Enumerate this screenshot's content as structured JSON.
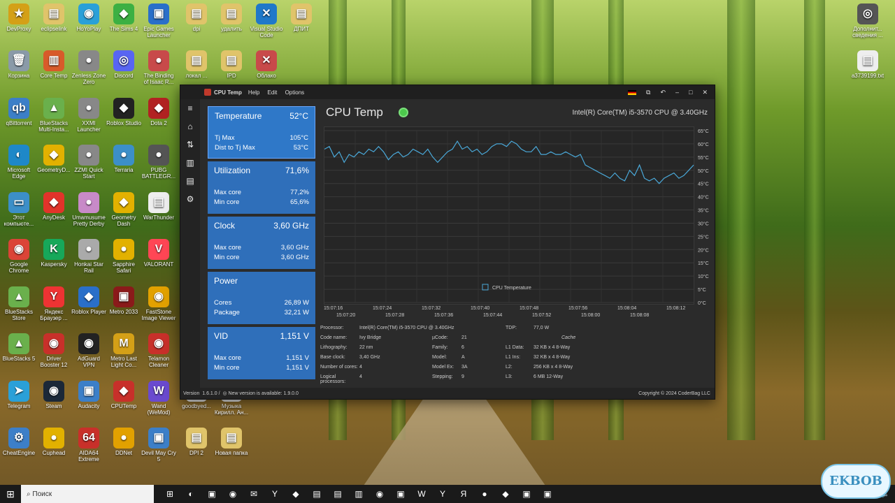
{
  "desktop_icons": [
    {
      "label": "DevProxy",
      "glyph": "★",
      "color": "#d4a017",
      "x": 2,
      "y": 5
    },
    {
      "label": "eclipselink",
      "glyph": "▤",
      "color": "#e0c46a",
      "x": 52,
      "y": 5
    },
    {
      "label": "HoYoPlay",
      "glyph": "◉",
      "color": "#2aa0d8",
      "x": 102,
      "y": 5
    },
    {
      "label": "The Sims 4",
      "glyph": "◆",
      "color": "#3cb043",
      "x": 152,
      "y": 5
    },
    {
      "label": "Epic Games Launcher",
      "glyph": "▣",
      "color": "#2a6fc9",
      "x": 202,
      "y": 5
    },
    {
      "label": "dpi",
      "glyph": "▤",
      "color": "#e0c46a",
      "x": 256,
      "y": 5
    },
    {
      "label": "удалить",
      "glyph": "▤",
      "color": "#e0c46a",
      "x": 306,
      "y": 5
    },
    {
      "label": "Visual Studio Code",
      "glyph": "✕",
      "color": "#1f78c9",
      "x": 356,
      "y": 5
    },
    {
      "label": "ДПИТ",
      "glyph": "▤",
      "color": "#e0c46a",
      "x": 406,
      "y": 5
    },
    {
      "label": "Корзина",
      "glyph": "🗑",
      "color": "#8a9aa8",
      "x": 2,
      "y": 72
    },
    {
      "label": "Core Temp",
      "glyph": "▥",
      "color": "#d85a2a",
      "x": 52,
      "y": 72
    },
    {
      "label": "Zenless Zone Zero",
      "glyph": "●",
      "color": "#888",
      "x": 102,
      "y": 72
    },
    {
      "label": "Discord",
      "glyph": "◎",
      "color": "#5865f2",
      "x": 152,
      "y": 72
    },
    {
      "label": "The Binding of Isaac R...",
      "glyph": "●",
      "color": "#c84a4a",
      "x": 202,
      "y": 72
    },
    {
      "label": "локал ...",
      "glyph": "▤",
      "color": "#e0c46a",
      "x": 256,
      "y": 72
    },
    {
      "label": "IPD",
      "glyph": "▤",
      "color": "#e0c46a",
      "x": 306,
      "y": 72
    },
    {
      "label": "Облако",
      "glyph": "✕",
      "color": "#c84a4a",
      "x": 356,
      "y": 72
    },
    {
      "label": "qBittorrent",
      "glyph": "qb",
      "color": "#3c7fc8",
      "x": 2,
      "y": 140
    },
    {
      "label": "BlueStacks Multi-Insta...",
      "glyph": "▲",
      "color": "#6ab04c",
      "x": 52,
      "y": 140
    },
    {
      "label": "XXMI Launcher",
      "glyph": "●",
      "color": "#888",
      "x": 102,
      "y": 140
    },
    {
      "label": "Roblox Studio",
      "glyph": "◆",
      "color": "#222",
      "x": 152,
      "y": 140
    },
    {
      "label": "Dota 2",
      "glyph": "◆",
      "color": "#b22222",
      "x": 202,
      "y": 140
    },
    {
      "label": "Microsoft Edge",
      "glyph": "◐",
      "color": "#1e88c8",
      "x": 2,
      "y": 207
    },
    {
      "label": "GeometryD...",
      "glyph": "◆",
      "color": "#e2b100",
      "x": 52,
      "y": 207
    },
    {
      "label": "ZZMI Quick Start",
      "glyph": "●",
      "color": "#888",
      "x": 102,
      "y": 207
    },
    {
      "label": "Terraria",
      "glyph": "●",
      "color": "#3c8fc8",
      "x": 152,
      "y": 207
    },
    {
      "label": "PUBG BATTLEGR...",
      "glyph": "●",
      "color": "#555",
      "x": 202,
      "y": 207
    },
    {
      "label": "Этот компьюте...",
      "glyph": "▭",
      "color": "#3c8fc8",
      "x": 2,
      "y": 275
    },
    {
      "label": "AnyDesk",
      "glyph": "◆",
      "color": "#e2332a",
      "x": 52,
      "y": 275
    },
    {
      "label": "Umamusume Pretty Derby",
      "glyph": "●",
      "color": "#c88ac8",
      "x": 102,
      "y": 275
    },
    {
      "label": "Geometry Dash",
      "glyph": "◆",
      "color": "#e2b100",
      "x": 152,
      "y": 275
    },
    {
      "label": "WarThunder",
      "glyph": "▤",
      "color": "#eee",
      "x": 202,
      "y": 275
    },
    {
      "label": "Google Chrome",
      "glyph": "◉",
      "color": "#db4437",
      "x": 2,
      "y": 342
    },
    {
      "label": "Kaspersky",
      "glyph": "K",
      "color": "#17a85a",
      "x": 52,
      "y": 342
    },
    {
      "label": "Honkai Star Rail",
      "glyph": "●",
      "color": "#aaa",
      "x": 102,
      "y": 342
    },
    {
      "label": "Sapphire Safari",
      "glyph": "●",
      "color": "#e2b100",
      "x": 152,
      "y": 342
    },
    {
      "label": "VALORANT",
      "glyph": "V",
      "color": "#ff4655",
      "x": 202,
      "y": 342
    },
    {
      "label": "BlueStacks Store",
      "glyph": "▲",
      "color": "#6ab04c",
      "x": 2,
      "y": 410
    },
    {
      "label": "Яндекс Браузер ...",
      "glyph": "Y",
      "color": "#e33",
      "x": 52,
      "y": 410
    },
    {
      "label": "Roblox Player",
      "glyph": "◆",
      "color": "#2a6fc9",
      "x": 102,
      "y": 410
    },
    {
      "label": "Metro 2033",
      "glyph": "▣",
      "color": "#8a1a1a",
      "x": 152,
      "y": 410
    },
    {
      "label": "FastStone Image Viewer",
      "glyph": "◉",
      "color": "#e2a100",
      "x": 202,
      "y": 410
    },
    {
      "label": "BlueStacks 5",
      "glyph": "▲",
      "color": "#6ab04c",
      "x": 2,
      "y": 477
    },
    {
      "label": "Driver Booster 12",
      "glyph": "◉",
      "color": "#c8302a",
      "x": 52,
      "y": 477
    },
    {
      "label": "AdGuard VPN",
      "glyph": "◉",
      "color": "#222",
      "x": 102,
      "y": 477
    },
    {
      "label": "Metro Last Light Co...",
      "glyph": "M",
      "color": "#d4a017",
      "x": 152,
      "y": 477
    },
    {
      "label": "Telamon Cleaner",
      "glyph": "◉",
      "color": "#c8302a",
      "x": 202,
      "y": 477
    },
    {
      "label": "Telegram",
      "glyph": "➤",
      "color": "#2aa0d8",
      "x": 2,
      "y": 545
    },
    {
      "label": "Steam",
      "glyph": "◉",
      "color": "#1b2838",
      "x": 52,
      "y": 545
    },
    {
      "label": "Audacity",
      "glyph": "▣",
      "color": "#3c7fc8",
      "x": 102,
      "y": 545
    },
    {
      "label": "CPUTemp",
      "glyph": "◆",
      "color": "#c8302a",
      "x": 152,
      "y": 545
    },
    {
      "label": "Wand (WeMod)",
      "glyph": "W",
      "color": "#6a4acf",
      "x": 202,
      "y": 545
    },
    {
      "label": "goodbyed...",
      "glyph": "▤",
      "color": "#eee",
      "x": 256,
      "y": 545
    },
    {
      "label": "Музыка Кирилл. Ан...",
      "glyph": "▤",
      "color": "#eee",
      "x": 306,
      "y": 545
    },
    {
      "label": "CheatEngine",
      "glyph": "⚙",
      "color": "#3c7fc8",
      "x": 2,
      "y": 612
    },
    {
      "label": "Cuphead",
      "glyph": "●",
      "color": "#e2b100",
      "x": 52,
      "y": 612
    },
    {
      "label": "AIDA64 Extreme",
      "glyph": "64",
      "color": "#c8302a",
      "x": 102,
      "y": 612
    },
    {
      "label": "DDNet",
      "glyph": "●",
      "color": "#e2a100",
      "x": 152,
      "y": 612
    },
    {
      "label": "Devil May Cry 5",
      "glyph": "▣",
      "color": "#3c7fc8",
      "x": 202,
      "y": 612
    },
    {
      "label": "DPI 2",
      "glyph": "▤",
      "color": "#e0c46a",
      "x": 256,
      "y": 612
    },
    {
      "label": "Новая папка",
      "glyph": "▤",
      "color": "#e0c46a",
      "x": 306,
      "y": 612
    },
    {
      "label": "Дополнит... сведения ...",
      "glyph": "◎",
      "color": "#555",
      "x": 1216,
      "y": 5
    },
    {
      "label": "a3739199.txt",
      "glyph": "▤",
      "color": "#eee",
      "x": 1216,
      "y": 72
    }
  ],
  "window": {
    "menu": {
      "title": "CPU Temp",
      "help": "Help",
      "edit": "Edit",
      "options": "Options"
    },
    "controls": {
      "minimize": "–",
      "maximize": "□",
      "close": "✕",
      "back": "↶",
      "screenshot": "⧉"
    },
    "sidebar": [
      "≡",
      "⌂",
      "⇅",
      "▥",
      "▤",
      "⚙"
    ],
    "header": {
      "app_name": "CPU Temp",
      "cpu_name": "Intel(R) Core(TM) i5-3570 CPU @ 3.40GHz"
    },
    "cards": [
      {
        "title": "Temperature",
        "value": "52°C",
        "rows": [
          {
            "k": "Tj Max",
            "v": "105°C"
          },
          {
            "k": "Dist to Tj Max",
            "v": "53°C"
          }
        ]
      },
      {
        "title": "Utilization",
        "value": "71,6%",
        "rows": [
          {
            "k": "Max core",
            "v": "77,2%"
          },
          {
            "k": "Min core",
            "v": "65,6%"
          }
        ]
      },
      {
        "title": "Clock",
        "value": "3,60 GHz",
        "rows": [
          {
            "k": "Max core",
            "v": "3,60 GHz"
          },
          {
            "k": "Min core",
            "v": "3,60 GHz"
          }
        ]
      },
      {
        "title": "Power",
        "value": "",
        "rows": [
          {
            "k": "Cores",
            "v": "26,89 W"
          },
          {
            "k": "Package",
            "v": "32,21 W"
          }
        ]
      },
      {
        "title": "VID",
        "value": "1,151 V",
        "rows": [
          {
            "k": "Max core",
            "v": "1,151 V"
          },
          {
            "k": "Min core",
            "v": "1,151 V"
          }
        ]
      }
    ],
    "info": {
      "col1": [
        {
          "k": "Processor:",
          "v": "Intel(R) Core(TM) i5-3570 CPU @ 3.40GHz"
        },
        {
          "k": "Code name:",
          "v": "Ivy Bridge"
        },
        {
          "k": "Lithography:",
          "v": "22 nm"
        },
        {
          "k": "Base clock:",
          "v": "3,40 GHz"
        },
        {
          "k": "Number of cores:",
          "v": "4"
        },
        {
          "k": "Logical processors:",
          "v": "4"
        }
      ],
      "col2": [
        {
          "k": "",
          "v": ""
        },
        {
          "k": "µCode:",
          "v": "21"
        },
        {
          "k": "Family:",
          "v": "6"
        },
        {
          "k": "Model:",
          "v": "A"
        },
        {
          "k": "Model Ex:",
          "v": "3A"
        },
        {
          "k": "Stepping:",
          "v": "9"
        }
      ],
      "col3": [
        {
          "k": "TDP:",
          "v": "77,0 W"
        },
        {
          "k": "",
          "v": "Cache"
        },
        {
          "k": "L1 Data:",
          "v": "32 KB x 4  8-Way"
        },
        {
          "k": "L1 Ins:",
          "v": "32 KB x 4  8-Way"
        },
        {
          "k": "L2:",
          "v": "256 KB x 4  8-Way"
        },
        {
          "k": "L3:",
          "v": "6 MB  12-Way"
        }
      ]
    },
    "status": {
      "version_label": "Version",
      "version": "1.6.1.0  /",
      "update": "New version is available: 1.9.0.0",
      "copyright": "Copyright © 2024 CoderBag LLC"
    }
  },
  "chart_data": {
    "type": "line",
    "series": [
      {
        "name": "CPU Temperature",
        "color": "#4aa8d8",
        "values": [
          58,
          59,
          55,
          57,
          53,
          56,
          55,
          57,
          56,
          58,
          57,
          59,
          57,
          54,
          56,
          57,
          55,
          56,
          58,
          57,
          56,
          58,
          55,
          53,
          55,
          57,
          58,
          61,
          58,
          59,
          57,
          58,
          56,
          57,
          59,
          60,
          60,
          59,
          61,
          60,
          58,
          57,
          57,
          59,
          56,
          56,
          57,
          56,
          56,
          57,
          56,
          55,
          56,
          52,
          51,
          50,
          49,
          48,
          47,
          49,
          47,
          46,
          50,
          48,
          52,
          47,
          46,
          47,
          45,
          47,
          48,
          49,
          47,
          48,
          50,
          52
        ]
      }
    ],
    "ylim": [
      0,
      65
    ],
    "yticks": [
      "65°C",
      "60°C",
      "55°C",
      "50°C",
      "45°C",
      "40°C",
      "35°C",
      "30°C",
      "25°C",
      "20°C",
      "15°C",
      "10°C",
      "5°C",
      "0°C"
    ],
    "xticks_top": [
      "15:07:16",
      "15:07:24",
      "15:07:32",
      "15:07:40",
      "15:07:48",
      "15:07:56",
      "15:08:04",
      "15:08:12"
    ],
    "xticks_bottom": [
      "15:07:20",
      "15:07:28",
      "15:07:36",
      "15:07:44",
      "15:07:52",
      "15:08:00",
      "15:08:08"
    ],
    "legend": "CPU Temperature",
    "grid": true
  },
  "taskbar": {
    "search_placeholder": "Поиск",
    "icons": [
      "⊞",
      "◐",
      "▣",
      "◉",
      "✉",
      "Y",
      "◆",
      "▤",
      "▤",
      "▥",
      "◉",
      "▣",
      "W",
      "Y",
      "Я",
      "●",
      "◆",
      "▣",
      "▣"
    ]
  },
  "watermark": "EKBOB"
}
